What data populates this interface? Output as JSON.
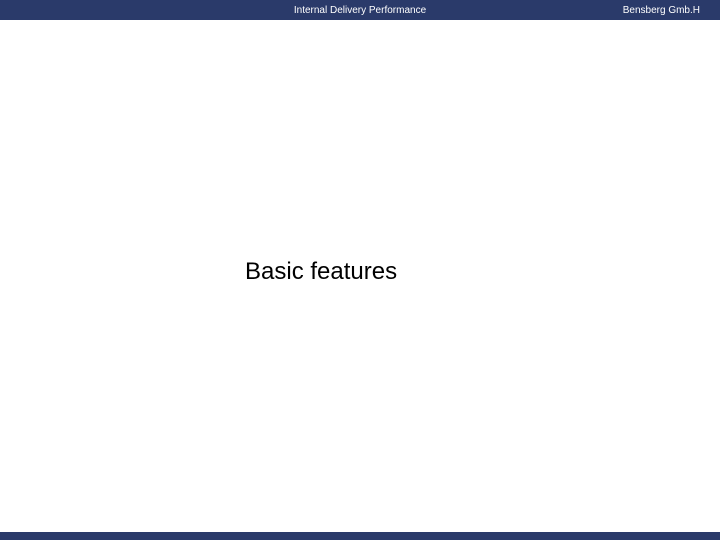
{
  "header": {
    "title": "Internal Delivery Performance",
    "company": "Bensberg Gmb.H"
  },
  "slide": {
    "heading": "Basic features"
  },
  "colors": {
    "banner": "#2a3a6a",
    "text": "#000000",
    "headerText": "#ffffff"
  }
}
